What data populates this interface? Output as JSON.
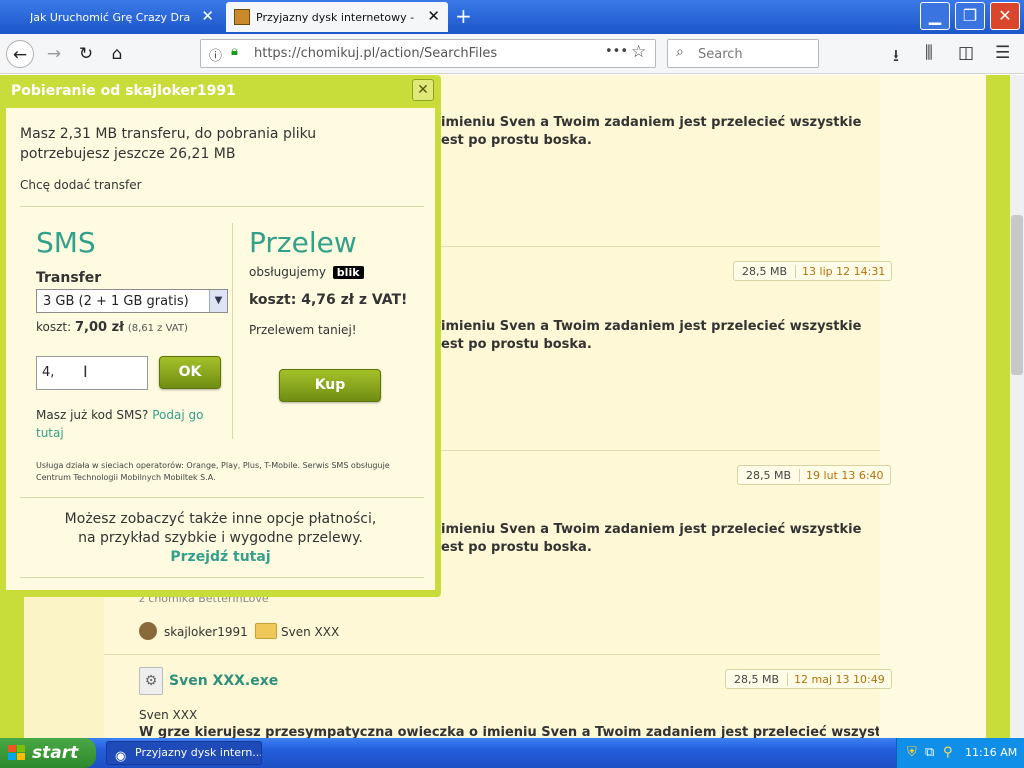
{
  "browser": {
    "tabs": [
      {
        "title": "Jak Uruchomić Grę Crazy Drake na"
      },
      {
        "title": "Przyjazny dysk internetowy - Chomikuj"
      }
    ],
    "url": "https://chomikuj.pl/action/SearchFiles",
    "search_placeholder": "Search",
    "icons": {
      "back": "←",
      "forward": "→",
      "reload": "↻",
      "home": "⌂",
      "more": "•••",
      "bookmark": "☆",
      "download": "⭳",
      "library": "⫼",
      "sidebar": "◫",
      "menu": "☰",
      "close": "✕",
      "newtab": "+",
      "minimize": "▁",
      "maximize": "❐"
    }
  },
  "modal": {
    "title": "Pobieranie od skajloker1991",
    "close": "✕",
    "transfer_info": "Masz 2,31 MB transferu, do pobrania pliku potrzebujesz jeszcze 26,21 MB",
    "add_transfer": "Chcę dodać transfer",
    "sms": {
      "title": "SMS",
      "transfer_label": "Transfer",
      "selected_option": "3 GB (2 + 1 GB gratis)",
      "cost_label": "koszt:",
      "cost_value": "7,00 zł",
      "cost_vat": "(8,61 z VAT)",
      "code_value": "4,",
      "ok_label": "OK",
      "code_question": "Masz już kod SMS?",
      "code_link": "Podaj go tutaj",
      "note": "Usługa działa w sieciach operatorów: Orange, Play, Plus, T-Mobile. Serwis SMS obsługuje Centrum Technologii Mobilnych Mobiltek S.A."
    },
    "przelew": {
      "title": "Przelew",
      "supports": "obsługujemy",
      "blik": "blik",
      "cost": "koszt: 4,76 zł z VAT!",
      "cheaper": "Przelewem taniej!",
      "buy_label": "Kup"
    },
    "other_options_line1": "Możesz zobaczyć także inne opcje płatności,",
    "other_options_line2": "na przykład szybkie i wygodne przelewy.",
    "other_options_link": "Przejdź tutaj"
  },
  "results": {
    "desc_line1": "imieniu Sven a Twoim zadaniem jest przelecieć wszystkie",
    "desc_line2": "est po prostu boska.",
    "files": [
      {
        "size": "28,5 MB",
        "date": "13 lip 12 14:31"
      },
      {
        "size": "28,5 MB",
        "date": "19 lut 13 6:40"
      },
      {
        "size": "28,5 MB",
        "date": "12 maj 13 10:49"
      }
    ],
    "from_user": "z chomika BetterInLove",
    "owner": "skajloker1991",
    "folder": "Sven XXX",
    "last_file_name": "Sven XXX.exe",
    "last_file_sub": "Sven XXX",
    "last_file_desc": "W grze kierujesz przesympatyczna owieczka o imieniu Sven a Twoim zadaniem jest przelecieć wszystkie"
  },
  "taskbar": {
    "start": "start",
    "item": "Przyjazny dysk intern...",
    "clock": "11:16 AM"
  }
}
